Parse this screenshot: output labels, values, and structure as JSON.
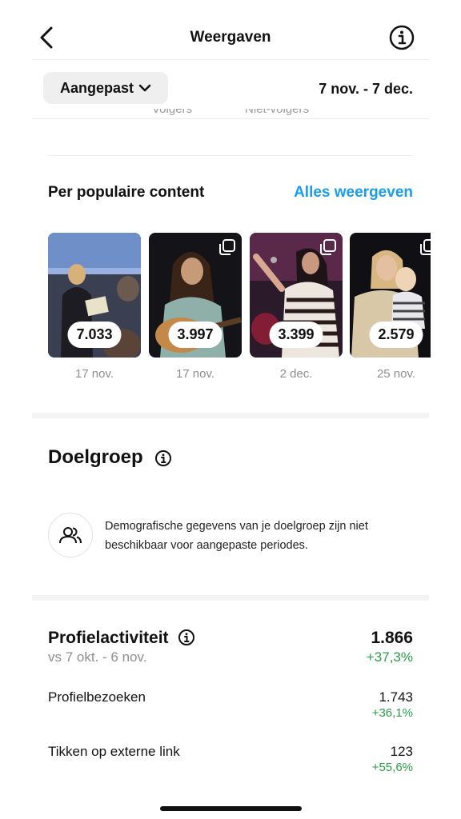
{
  "header": {
    "title": "Weergaven",
    "back_icon": "chevron-left-icon",
    "info_icon": "info-circle-icon"
  },
  "filter": {
    "range_label": "Aangepast",
    "range_dates": "7 nov. - 7 dec."
  },
  "cut_labels": [
    "Volgers",
    "Niet-volgers"
  ],
  "popular": {
    "title": "Per populaire content",
    "see_all": "Alles weergeven",
    "items": [
      {
        "views": "7.033",
        "date": "17 nov.",
        "carousel": false
      },
      {
        "views": "3.997",
        "date": "17 nov.",
        "carousel": true
      },
      {
        "views": "3.399",
        "date": "2 dec.",
        "carousel": true
      },
      {
        "views": "2.579",
        "date": "25 nov.",
        "carousel": true
      }
    ]
  },
  "audience": {
    "title": "Doelgroep",
    "icon": "people-icon",
    "message": "Demografische gegevens van je doelgroep zijn niet beschikbaar voor aangepaste periodes."
  },
  "profile_activity": {
    "title": "Profielactiviteit",
    "compare": "vs 7 okt. - 6 nov.",
    "total": "1.866",
    "total_delta": "+37,3%",
    "rows": [
      {
        "label": "Profielbezoeken",
        "value": "1.743",
        "delta": "+36,1%"
      },
      {
        "label": "Tikken op externe link",
        "value": "123",
        "delta": "+55,6%"
      }
    ]
  },
  "colors": {
    "accent_link": "#1a9cf0",
    "positive": "#2a9d4a"
  }
}
